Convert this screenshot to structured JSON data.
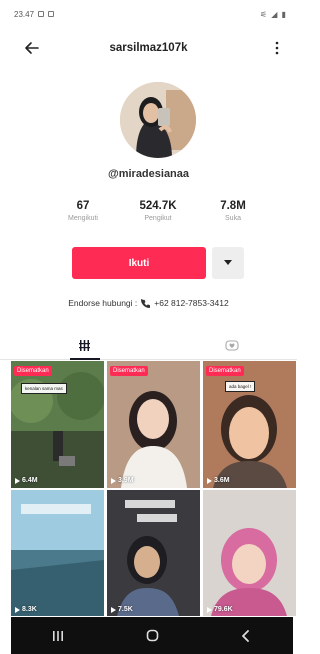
{
  "status_bar": {
    "time": "23.47",
    "left_icons": [
      "gallery-icon",
      "notification-icon"
    ],
    "right_text": "⚟ ◢ ▮"
  },
  "header": {
    "title": "sarsilmaz107k",
    "back_icon": "arrow-left-icon",
    "more_icon": "vertical-dots-icon"
  },
  "profile": {
    "handle": "@miradesianaa",
    "stats": [
      {
        "value": "67",
        "label": "Mengikuti"
      },
      {
        "value": "524.7K",
        "label": "Pengikut"
      },
      {
        "value": "7.8M",
        "label": "Suka"
      }
    ],
    "follow_label": "Ikuti",
    "endorse_label": "Endorse hubungi :",
    "endorse_phone": "+62 812-7853-3412"
  },
  "tabs": [
    {
      "name": "videos",
      "icon": "grid-icon",
      "active": true
    },
    {
      "name": "liked",
      "icon": "liked-icon",
      "active": false
    }
  ],
  "videos": [
    {
      "badge": "Disematkan",
      "caption": "kenalan sama mas",
      "views": "6.4M",
      "colors": [
        "#5d7c4b",
        "#2f3b2a",
        "#8aa176"
      ]
    },
    {
      "badge": "Disematkan",
      "caption": "",
      "views": "3.9M",
      "colors": [
        "#c7a188",
        "#6f4c3a",
        "#e8d7c9"
      ]
    },
    {
      "badge": "Disematkan",
      "caption": "ada bagel !",
      "views": "3.6M",
      "colors": [
        "#d79c7d",
        "#8b5a3c",
        "#f1c9a8"
      ]
    },
    {
      "badge": "",
      "caption": "",
      "views": "8.3K",
      "colors": [
        "#7fb8d6",
        "#3a6b82",
        "#b9dcea"
      ]
    },
    {
      "badge": "",
      "caption": "",
      "views": "7.5K",
      "colors": [
        "#3a3a3f",
        "#6d5e52",
        "#d6b48c"
      ]
    },
    {
      "badge": "",
      "caption": "",
      "views": "79.6K",
      "colors": [
        "#c8c3c0",
        "#d86ba0",
        "#f0e8e2"
      ]
    }
  ],
  "nav_bar": {
    "buttons": [
      "recent-apps-icon",
      "home-icon",
      "back-icon"
    ]
  },
  "colors": {
    "accent": "#fe2c55",
    "text": "#161823",
    "secondary_button": "#eeeeef",
    "nav_bar": "#0f0f0f"
  }
}
